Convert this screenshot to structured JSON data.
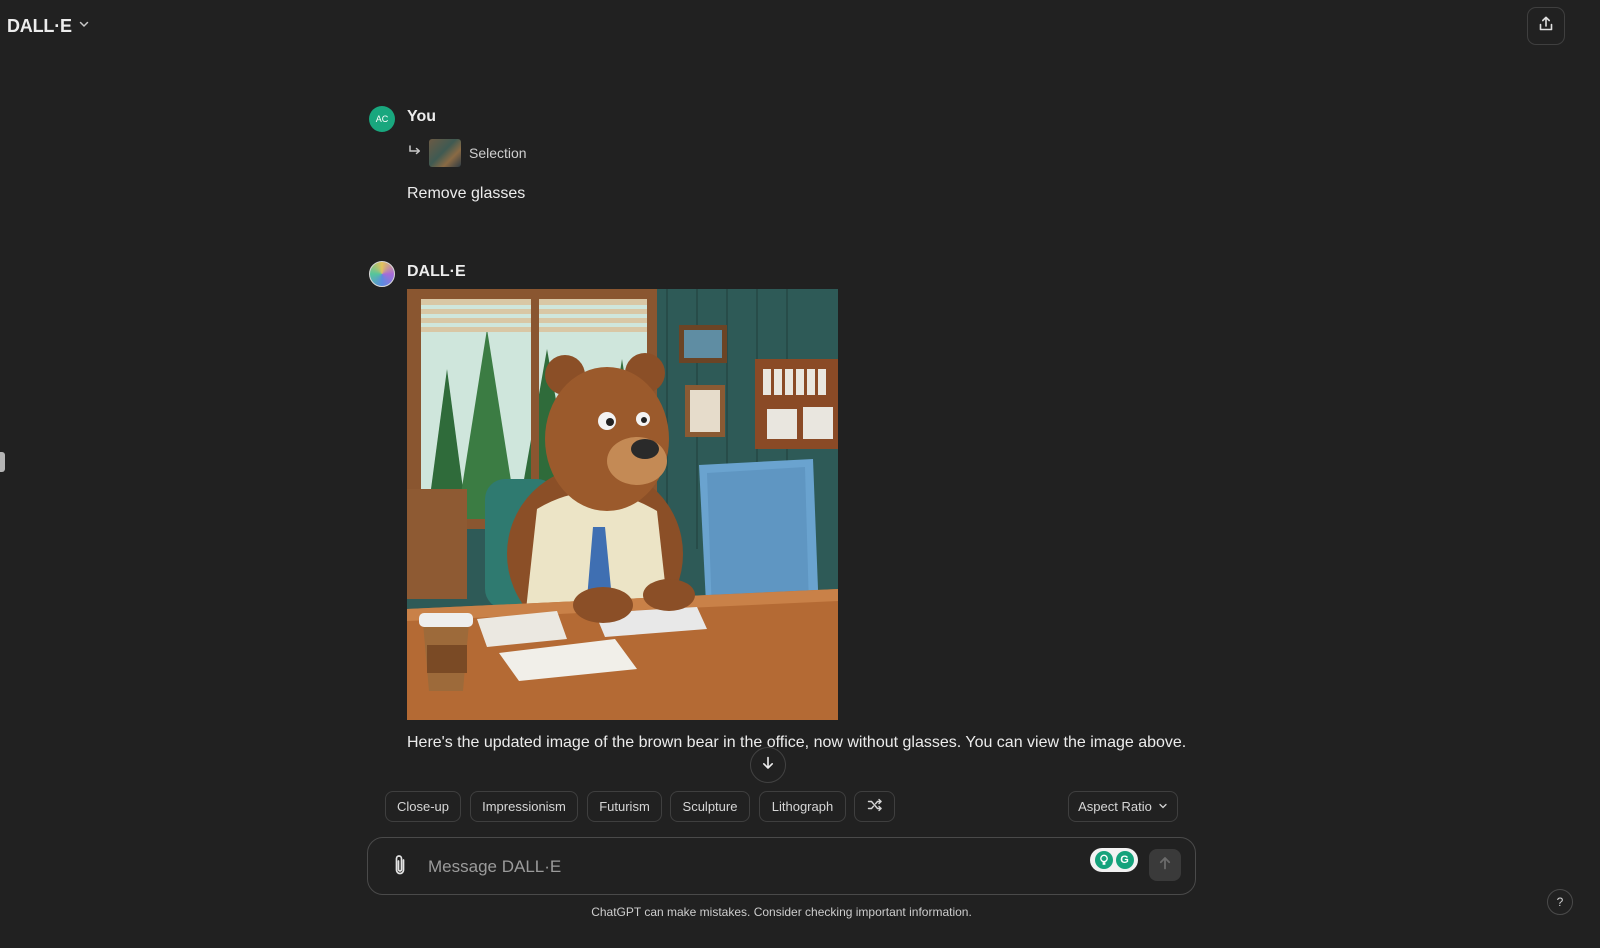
{
  "header": {
    "model_name": "DALL·E",
    "model_icon": "chevron-down-icon",
    "share_icon": "share-icon"
  },
  "conversation": {
    "user_message": {
      "avatar_initials": "AC",
      "author": "You",
      "reference_label": "Selection",
      "text": "Remove glasses"
    },
    "assistant_message": {
      "author": "DALL·E",
      "image_description_icon": "generated-image",
      "text": "Here's the updated image of the brown bear in the office, now without glasses. You can view the image above."
    }
  },
  "style_chips": [
    "Close-up",
    "Impressionism",
    "Futurism",
    "Sculpture",
    "Lithograph"
  ],
  "shuffle_icon": "shuffle-icon",
  "aspect_ratio_label": "Aspect Ratio",
  "composer": {
    "placeholder": "Message DALL·E",
    "value": ""
  },
  "disclaimer": "ChatGPT can make mistakes. Consider checking important information.",
  "help_label": "?",
  "colors": {
    "background": "#212121",
    "text": "#ececec",
    "user_avatar": "#19a77e",
    "grammarly": "#15a37c"
  }
}
